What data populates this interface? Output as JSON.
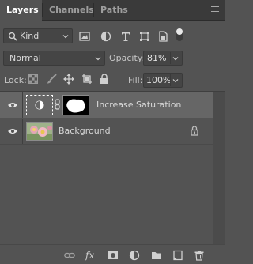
{
  "tabs": [
    {
      "label": "Layers",
      "active": true
    },
    {
      "label": "Channels",
      "active": false
    },
    {
      "label": "Paths",
      "active": false
    }
  ],
  "filter": {
    "kind_label": "Kind",
    "icons": [
      "pixel-layer-filter-icon",
      "adjustment-layer-filter-icon",
      "type-layer-filter-icon",
      "shape-layer-filter-icon",
      "smart-object-filter-icon",
      "filter-toggle-icon"
    ]
  },
  "blend": {
    "mode": "Normal",
    "opacity_label": "Opacity:",
    "opacity_value": "81%"
  },
  "lock": {
    "label": "Lock:",
    "fill_label": "Fill:",
    "fill_value": "100%",
    "icons": [
      "lock-transparent-pixels-icon",
      "lock-image-pixels-icon",
      "lock-position-icon",
      "prevent-autonest-icon",
      "lock-all-icon"
    ]
  },
  "layers": [
    {
      "name": "Increase Saturation",
      "type": "adjustment",
      "visible": true,
      "selected": true,
      "has_mask": true
    },
    {
      "name": "Background",
      "type": "pixel",
      "visible": true,
      "selected": false,
      "locked": true
    }
  ],
  "bottom_icons": [
    "link-layers-icon",
    "fx-icon",
    "add-mask-icon",
    "new-adjustment-layer-icon",
    "new-group-icon",
    "new-layer-icon",
    "delete-layer-icon"
  ],
  "colors": {
    "panel_bg": "#535353",
    "tab_bar_bg": "#3a3a3a",
    "selected_row_bg": "#666666",
    "field_bg": "#454545"
  }
}
